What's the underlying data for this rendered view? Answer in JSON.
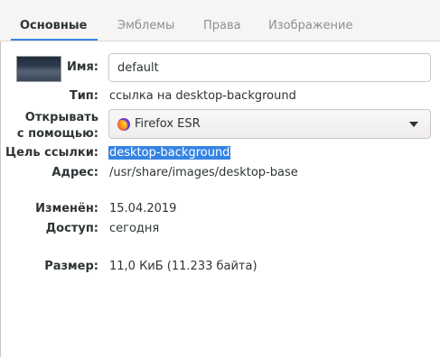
{
  "tabs": [
    {
      "label": "Основные",
      "active": true
    },
    {
      "label": "Эмблемы",
      "active": false
    },
    {
      "label": "Права",
      "active": false
    },
    {
      "label": "Изображение",
      "active": false
    }
  ],
  "fields": {
    "name_label": "Имя:",
    "name_value": "default",
    "type_label": "Тип:",
    "type_value": "ссылка на desktop-background",
    "open_with_label_line1": "Открывать",
    "open_with_label_line2": "с помощью:",
    "open_with_value": "Firefox ESR",
    "link_target_label": "Цель ссылки:",
    "link_target_value": "desktop-background",
    "address_label": "Адрес:",
    "address_value": "/usr/share/images/desktop-base",
    "modified_label": "Изменён:",
    "modified_value": "15.04.2019",
    "accessed_label": "Доступ:",
    "accessed_value": "сегодня",
    "size_label": "Размер:",
    "size_value": "11,0 КиБ (11.233 байта)"
  },
  "icons": {
    "thumbnail": "image-thumbnail",
    "app_icon": "firefox-icon",
    "dropdown": "chevron-down-icon"
  },
  "colors": {
    "accent": "#3584e4",
    "selection_text": "#ffffff"
  }
}
